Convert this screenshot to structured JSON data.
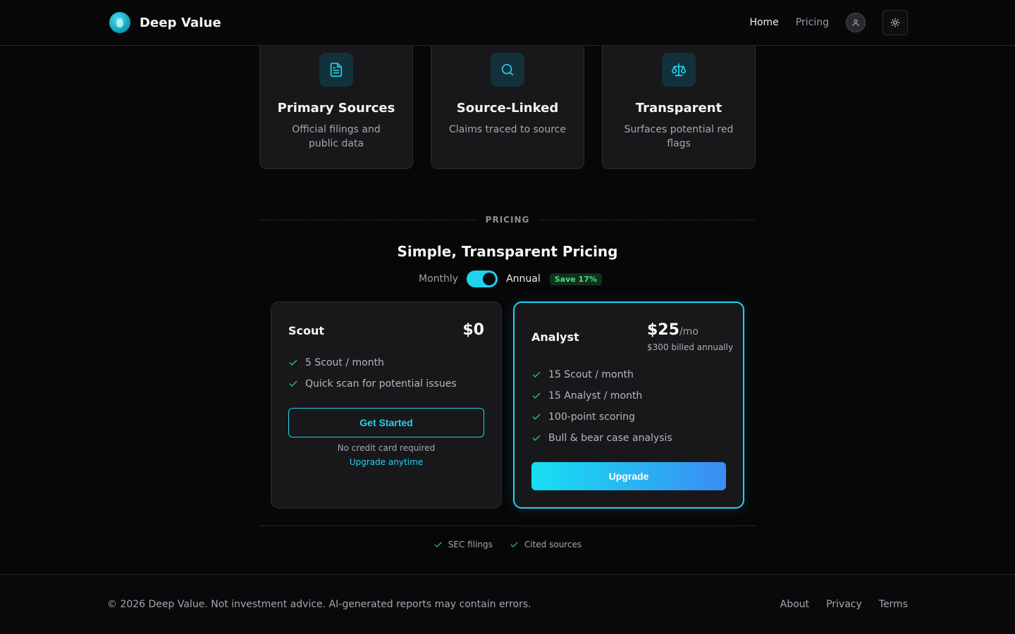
{
  "header": {
    "brand": "Deep Value",
    "nav": [
      {
        "label": "Home",
        "active": true
      },
      {
        "label": "Pricing",
        "active": false
      }
    ],
    "icons": {
      "account": "user-icon",
      "theme": "sun-icon"
    }
  },
  "features": [
    {
      "icon": "document-icon",
      "title": "Primary Sources",
      "desc": "Official filings and public data"
    },
    {
      "icon": "search-icon",
      "title": "Source-Linked",
      "desc": "Claims traced to source"
    },
    {
      "icon": "scale-icon",
      "title": "Transparent",
      "desc": "Surfaces potential red flags"
    }
  ],
  "pricing": {
    "eyebrow": "PRICING",
    "title": "Simple, Transparent Pricing",
    "billing": {
      "monthly": "Monthly",
      "annual": "Annual",
      "selected": "Annual",
      "save_badge": "Save 17%"
    },
    "plans": [
      {
        "name": "Scout",
        "price": "$0",
        "features": [
          "5 Scout / month",
          "Quick scan for potential issues"
        ],
        "cta": "Get Started",
        "note": "No credit card required",
        "link": "Upgrade anytime"
      },
      {
        "name": "Analyst",
        "price": "$25",
        "period": "/mo",
        "billed": "$300 billed annually",
        "features": [
          "15 Scout / month",
          "15 Analyst / month",
          "100-point scoring",
          "Bull & bear case analysis"
        ],
        "cta": "Upgrade"
      }
    ],
    "trust": [
      "SEC filings",
      "Cited sources"
    ]
  },
  "footer": {
    "copyright": "© 2026 Deep Value. Not investment advice. AI-generated reports may contain errors.",
    "links": [
      "About",
      "Privacy",
      "Terms"
    ]
  },
  "colors": {
    "accent": "#22d3ee",
    "check": "#22c55e",
    "background": "#070708",
    "card": "#18181b"
  }
}
